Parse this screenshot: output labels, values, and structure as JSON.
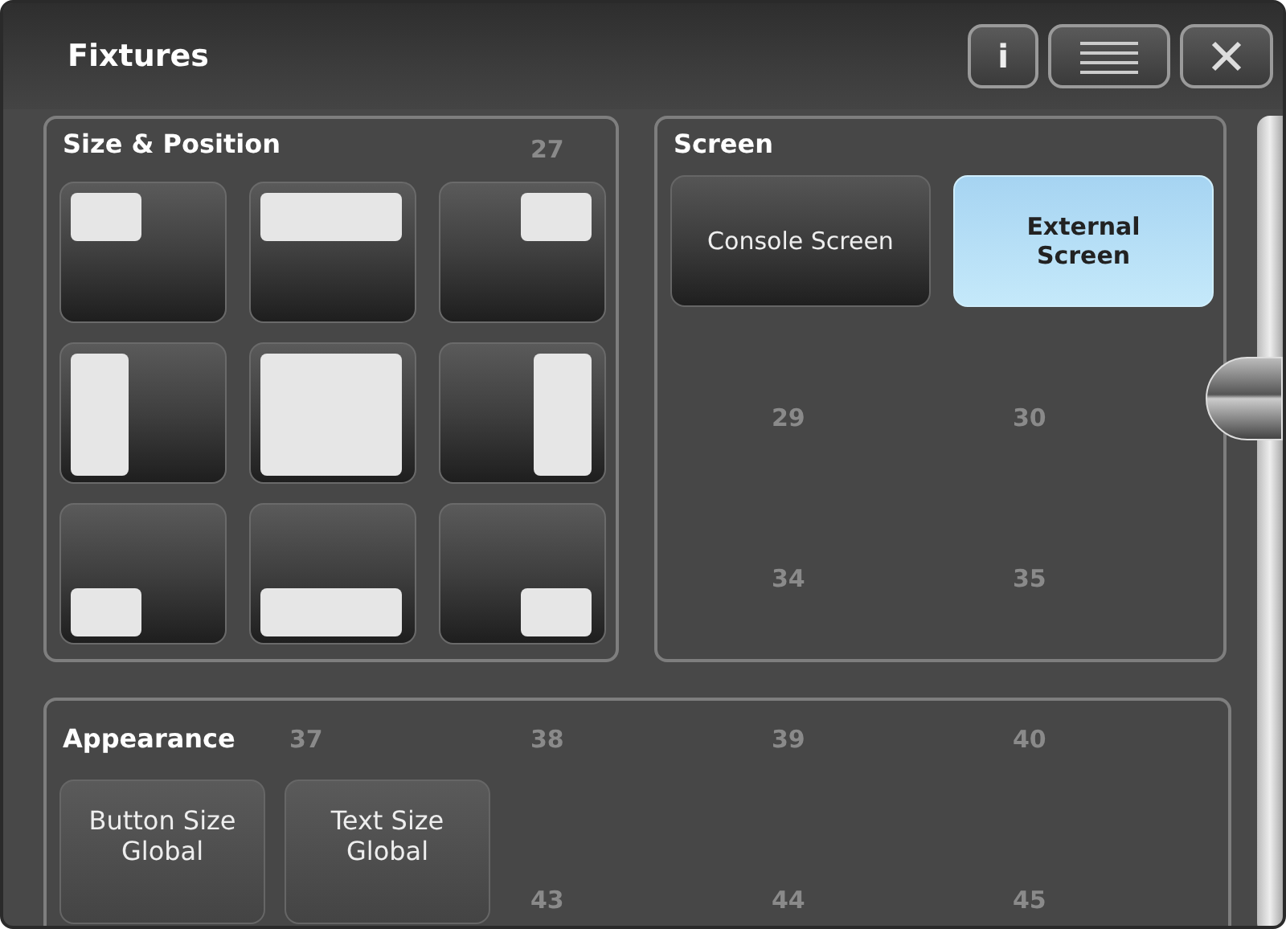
{
  "window": {
    "title": "Fixtures"
  },
  "title_buttons": [
    {
      "kind": "info",
      "label": "i"
    },
    {
      "kind": "menu"
    },
    {
      "kind": "close"
    }
  ],
  "background_grid": {
    "rows": [
      [
        null,
        null,
        "27",
        null,
        null
      ],
      [
        null,
        null,
        null,
        "29",
        "30"
      ],
      [
        null,
        null,
        null,
        "34",
        "35"
      ],
      [
        null,
        "37",
        "38",
        "39",
        "40"
      ],
      [
        null,
        null,
        "43",
        "44",
        "45"
      ]
    ]
  },
  "size_position": {
    "title": "Size & Position",
    "buttons": [
      {
        "kind": "top-left"
      },
      {
        "kind": "top"
      },
      {
        "kind": "top-right"
      },
      {
        "kind": "left"
      },
      {
        "kind": "full"
      },
      {
        "kind": "right"
      },
      {
        "kind": "bottom-left"
      },
      {
        "kind": "bottom"
      },
      {
        "kind": "bottom-right"
      }
    ]
  },
  "screen": {
    "title": "Screen",
    "options": [
      {
        "label": "Console Screen",
        "selected": false
      },
      {
        "label": "External Screen",
        "selected": true
      }
    ]
  },
  "appearance": {
    "title": "Appearance",
    "buttons": [
      {
        "label": "Button Size Global"
      },
      {
        "label": "Text Size Global"
      }
    ]
  }
}
